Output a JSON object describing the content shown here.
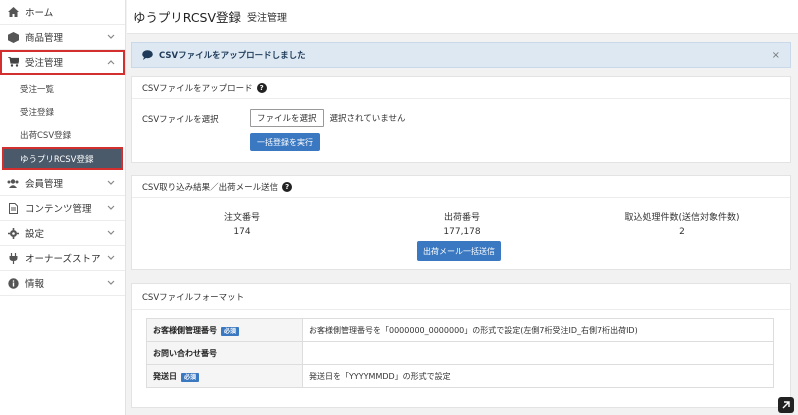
{
  "sidebar": {
    "home": {
      "label": "ホーム",
      "icon": "home-icon"
    },
    "products": {
      "label": "商品管理",
      "icon": "box-icon"
    },
    "orders": {
      "label": "受注管理",
      "icon": "cart-icon"
    },
    "order_sub": [
      "受注一覧",
      "受注登録",
      "出荷CSV登録",
      "ゆうプリRCSV登録"
    ],
    "members": {
      "label": "会員管理",
      "icon": "users-icon"
    },
    "contents": {
      "label": "コンテンツ管理",
      "icon": "file-icon"
    },
    "settings": {
      "label": "設定",
      "icon": "gear-icon"
    },
    "owners": {
      "label": "オーナーズストア",
      "icon": "plug-icon"
    },
    "info": {
      "label": "情報",
      "icon": "info-icon"
    }
  },
  "header": {
    "title": "ゆうプリRCSV登録",
    "subtitle": "受注管理"
  },
  "alert": {
    "message": "CSVファイルをアップロードしました",
    "close": "×"
  },
  "upload": {
    "heading": "CSVファイルをアップロード",
    "field_label": "CSVファイルを選択",
    "file_button": "ファイルを選択",
    "no_file": "選択されていません",
    "submit": "一括登録を実行"
  },
  "result": {
    "heading": "CSV取り込み結果／出荷メール送信",
    "cols": [
      {
        "label": "注文番号",
        "value": "174"
      },
      {
        "label": "出荷番号",
        "value": "177,178"
      },
      {
        "label": "取込処理件数(送信対象件数)",
        "value": "2"
      }
    ],
    "send_button": "出荷メール一括送信"
  },
  "format": {
    "heading": "CSVファイルフォーマット",
    "rows": [
      {
        "name": "お客様側管理番号",
        "required": "必須",
        "desc": "お客様側管理番号を「0000000_0000000」の形式で設定(左側7桁受注ID_右側7桁出荷ID)"
      },
      {
        "name": "お問い合わせ番号",
        "required": "",
        "desc": ""
      },
      {
        "name": "発送日",
        "required": "必須",
        "desc": "発送日を「YYYYMMDD」の形式で設定"
      }
    ]
  }
}
